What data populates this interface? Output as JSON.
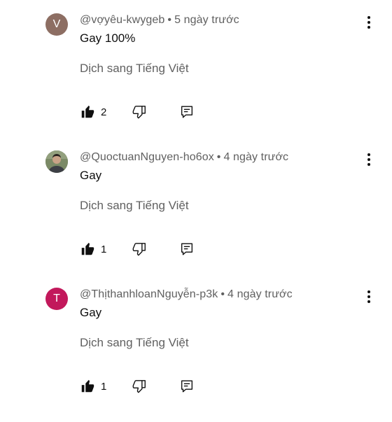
{
  "comments": [
    {
      "avatar_letter": "V",
      "avatar_color": "#8d6e63",
      "author": "@vợyêu-kwygeb",
      "time": "5 ngày trước",
      "text": "Gay 100%",
      "translate": "Dịch sang Tiếng Việt",
      "likes": "2"
    },
    {
      "avatar_letter": "",
      "avatar_color": "#6f7a5c",
      "author": "@QuoctuanNguyen-ho6ox",
      "time": "4 ngày trước",
      "text": "Gay",
      "translate": "Dịch sang Tiếng Việt",
      "likes": "1"
    },
    {
      "avatar_letter": "T",
      "avatar_color": "#c2185b",
      "author": "@ThịthanhloanNguyễn-p3k",
      "time": "4 ngày trước",
      "text": "Gay",
      "translate": "Dịch sang Tiếng Việt",
      "likes": "1"
    }
  ],
  "separator": "•",
  "icons": {
    "like": "thumbs-up-filled-icon",
    "dislike": "thumbs-down-outline-icon",
    "reply": "reply-comment-icon",
    "menu": "more-vertical-icon"
  }
}
